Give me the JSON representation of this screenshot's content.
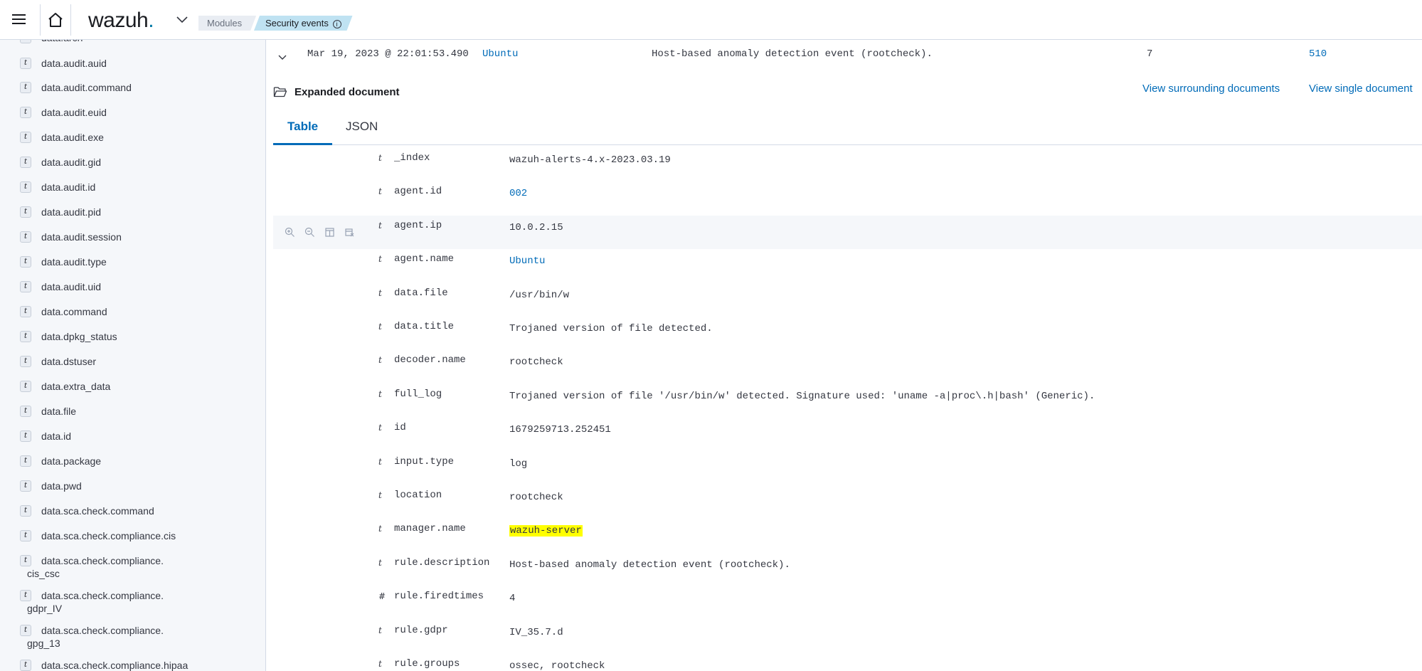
{
  "header": {
    "logo_text": "wazuh",
    "logo_dot": ".",
    "breadcrumbs": [
      "Modules",
      "Security events"
    ],
    "info_glyph": "i"
  },
  "sidebar": {
    "fields": [
      {
        "type": "t",
        "name": "data.arch"
      },
      {
        "type": "t",
        "name": "data.audit.auid"
      },
      {
        "type": "t",
        "name": "data.audit.command"
      },
      {
        "type": "t",
        "name": "data.audit.euid"
      },
      {
        "type": "t",
        "name": "data.audit.exe"
      },
      {
        "type": "t",
        "name": "data.audit.gid"
      },
      {
        "type": "t",
        "name": "data.audit.id"
      },
      {
        "type": "t",
        "name": "data.audit.pid"
      },
      {
        "type": "t",
        "name": "data.audit.session"
      },
      {
        "type": "t",
        "name": "data.audit.type"
      },
      {
        "type": "t",
        "name": "data.audit.uid"
      },
      {
        "type": "t",
        "name": "data.command"
      },
      {
        "type": "t",
        "name": "data.dpkg_status"
      },
      {
        "type": "t",
        "name": "data.dstuser"
      },
      {
        "type": "t",
        "name": "data.extra_data"
      },
      {
        "type": "t",
        "name": "data.file"
      },
      {
        "type": "t",
        "name": "data.id"
      },
      {
        "type": "t",
        "name": "data.package"
      },
      {
        "type": "t",
        "name": "data.pwd"
      },
      {
        "type": "t",
        "name": "data.sca.check.command"
      },
      {
        "type": "t",
        "name": "data.sca.check.compliance.cis"
      },
      {
        "type": "t",
        "name": "data.sca.check.compliance.",
        "name2": "cis_csc"
      },
      {
        "type": "t",
        "name": "data.sca.check.compliance.",
        "name2": "gdpr_IV"
      },
      {
        "type": "t",
        "name": "data.sca.check.compliance.",
        "name2": "gpg_13"
      },
      {
        "type": "t",
        "name": "data.sca.check.compliance.hipaa"
      }
    ]
  },
  "document_row": {
    "timestamp": "Mar 19, 2023 @ 22:01:53.490",
    "agent_name": "Ubuntu",
    "description": "Host-based anomaly detection event (rootcheck).",
    "level": "7",
    "rule_id": "510"
  },
  "expanded": {
    "title": "Expanded document",
    "view_surrounding": "View surrounding documents",
    "view_single": "View single document",
    "tabs": [
      "Table",
      "JSON"
    ],
    "active_tab": "Table"
  },
  "fields": [
    {
      "type": "t",
      "name": "_index",
      "value": "wazuh-alerts-4.x-2023.03.19"
    },
    {
      "type": "t",
      "name": "agent.id",
      "value": "002",
      "link": true
    },
    {
      "type": "t",
      "name": "agent.ip",
      "value": "10.0.2.15",
      "hover": true
    },
    {
      "type": "t",
      "name": "agent.name",
      "value": "Ubuntu",
      "link": true
    },
    {
      "type": "t",
      "name": "data.file",
      "value": "/usr/bin/w"
    },
    {
      "type": "t",
      "name": "data.title",
      "value": "Trojaned version of file detected."
    },
    {
      "type": "t",
      "name": "decoder.name",
      "value": "rootcheck"
    },
    {
      "type": "t",
      "name": "full_log",
      "value": "Trojaned version of file '/usr/bin/w' detected. Signature used: 'uname -a|proc\\.h|bash' (Generic)."
    },
    {
      "type": "t",
      "name": "id",
      "value": "1679259713.252451"
    },
    {
      "type": "t",
      "name": "input.type",
      "value": "log"
    },
    {
      "type": "t",
      "name": "location",
      "value": "rootcheck"
    },
    {
      "type": "t",
      "name": "manager.name",
      "value": "wazuh-server",
      "highlight": true
    },
    {
      "type": "t",
      "name": "rule.description",
      "value": "Host-based anomaly detection event (rootcheck)."
    },
    {
      "type": "#",
      "name": "rule.firedtimes",
      "value": "4"
    },
    {
      "type": "t",
      "name": "rule.gdpr",
      "value": "IV_35.7.d"
    },
    {
      "type": "t",
      "name": "rule.groups",
      "value": "ossec, rootcheck"
    }
  ],
  "colors": {
    "accent": "#006bb8",
    "highlight": "#ffff00",
    "sidebar_bg": "#f5f7fa",
    "breadcrumb_active": "#bfe2f2"
  },
  "icons": {
    "row_actions": [
      "zoom-in-icon",
      "zoom-out-icon",
      "toggle-column-icon",
      "filter-exists-icon"
    ]
  }
}
